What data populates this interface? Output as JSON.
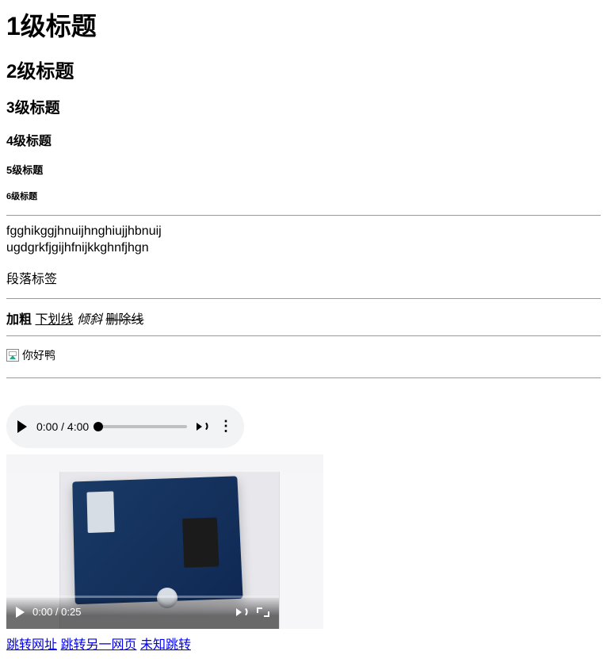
{
  "headings": {
    "h1": "1级标题",
    "h2": "2级标题",
    "h3": "3级标题",
    "h4": "4级标题",
    "h5": "5级标题",
    "h6": "6级标题"
  },
  "body_lines": {
    "line1": "fgghikggjhnuijhnghiujjhbnuij",
    "line2": "ugdgrkfjgijhfnijkkghnfjhgn"
  },
  "paragraph_label": "段落标签",
  "styles": {
    "bold": "加粗",
    "underline": "下划线",
    "italic": "倾斜",
    "strike": "删除线"
  },
  "image_alt": "你好鸭",
  "audio": {
    "time": "0:00 / 4:00"
  },
  "video": {
    "time": "0:00 / 0:25"
  },
  "links": {
    "l1": "跳转网址",
    "l2": "跳转另一网页",
    "l3": "未知跳转"
  }
}
